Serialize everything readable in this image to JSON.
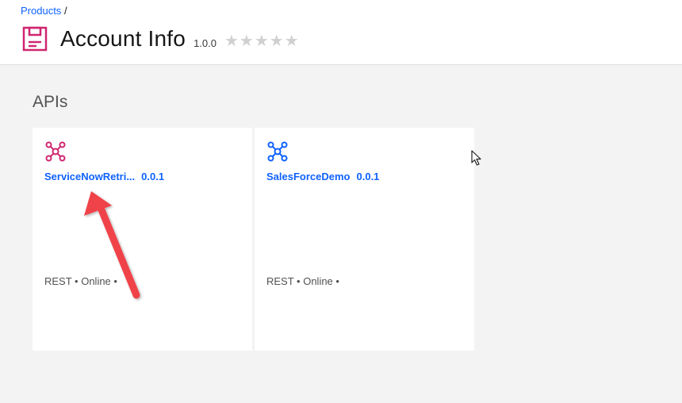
{
  "breadcrumb": {
    "link": "Products",
    "separator": "/"
  },
  "header": {
    "title": "Account Info",
    "version": "1.0.0",
    "rating": 0,
    "rating_max": 5,
    "stars": "★★★★★",
    "icon": "product-box-icon"
  },
  "section": {
    "title": "APIs"
  },
  "apis": [
    {
      "name": "ServiceNowRetri...",
      "version": "0.0.1",
      "meta": "REST • Online •",
      "icon": "api-network-icon",
      "icon_color": "#d02670"
    },
    {
      "name": "SalesForceDemo",
      "version": "0.0.1",
      "meta": "REST • Online •",
      "icon": "api-network-icon",
      "icon_color": "#0f62fe"
    }
  ],
  "colors": {
    "link": "#0f62fe",
    "product_icon": "#d02670",
    "annotation_arrow": "#f0434a"
  }
}
